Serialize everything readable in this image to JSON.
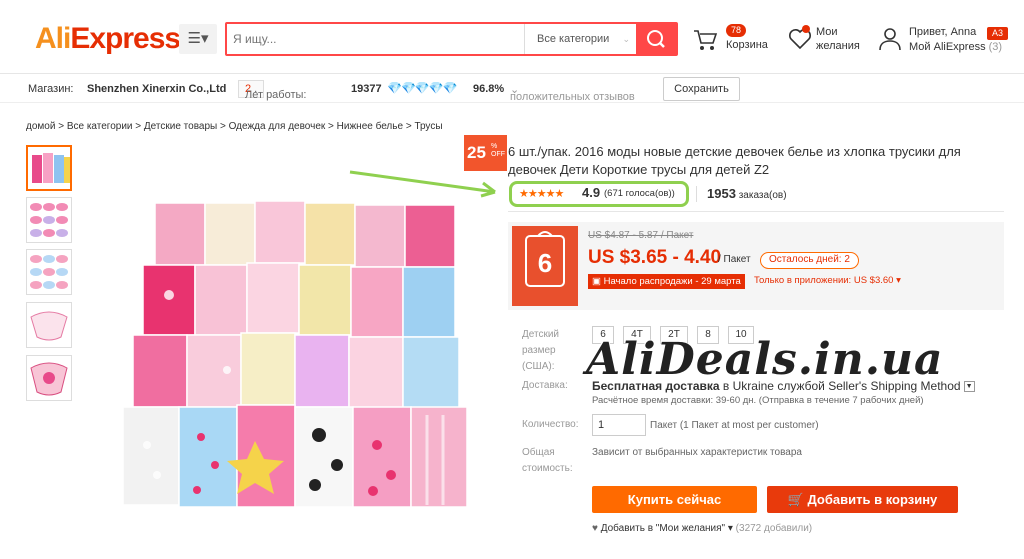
{
  "header": {
    "logo_ali": "Ali",
    "logo_express": "Express",
    "logo_mark": "®",
    "search_placeholder": "Я ищу...",
    "search_category": "Все категории",
    "cart_count": "78",
    "cart_label": "Корзина",
    "wish_label_1": "Мои",
    "wish_label_2": "желания",
    "greeting": "Привет, Anna",
    "user_badge": "A3",
    "my_ali": "Мой AliExpress",
    "my_ali_count": "(3)"
  },
  "store": {
    "label": "Магазин:",
    "name": "Shenzhen Xinerxin Co.,Ltd",
    "years_label": "Лет работы:",
    "years": "2",
    "score": "19377",
    "feedback": "96.8%",
    "feedback_label": "положительных отзывов",
    "save_label": "Сохранить"
  },
  "breadcrumb": "домой > Все категории > Детские товары > Одежда для девочек > Нижнее белье > Трусы",
  "product": {
    "discount": "25",
    "discount_pct": "%",
    "discount_off": "OFF",
    "title": "6 шт./упак. 2016 моды новые детские девочек белье из хлопка трусики для девочек Дети Короткие трусы для детей Z2",
    "stars": "★★★★★",
    "rating": "4.9",
    "votes": "(671 голоса(ов))",
    "orders_count": "1953",
    "orders_label": "заказа(ов)",
    "old_price": "US $4.87 - 5.87 / Пакет",
    "price": "US $3.65 - 4.40",
    "price_unit": "/ Пакет",
    "days_left": "Осталось дней: 2",
    "sale_start": "Начало распродажи - 29 марта",
    "app_price": "Только в приложении: US $3.60",
    "size_label_1": "Детский",
    "size_label_2": "размер",
    "size_label_3": "(США):",
    "sizes": [
      "6",
      "4T",
      "2T",
      "8",
      "10"
    ],
    "shipping_label": "Доставка:",
    "shipping_free": "Бесплатная доставка",
    "shipping_to": "в  Ukraine службой Seller's Shipping Method",
    "shipping_time": "Расчётное время доставки: 39-60 дн. (Отправка в течение 7 рабочих дней)",
    "qty_label": "Количество:",
    "qty_value": "1",
    "qty_unit": "Пакет (1 Пакет at most per customer)",
    "total_label_1": "Общая",
    "total_label_2": "стоимость:",
    "total_value": "Зависит от выбранных характеристик товара",
    "buy_now": "Купить сейчас",
    "add_to_cart": "Добавить в корзину",
    "add_wish": "Добавить в \"Мои желания\"",
    "wish_count": "(3272 добавили)"
  },
  "watermark": "AliDeals.in.ua",
  "colors": {
    "accent": "#ff4747",
    "price_red": "#e62e04",
    "orange": "#ff6a00",
    "highlight_green": "#8fd04f"
  }
}
